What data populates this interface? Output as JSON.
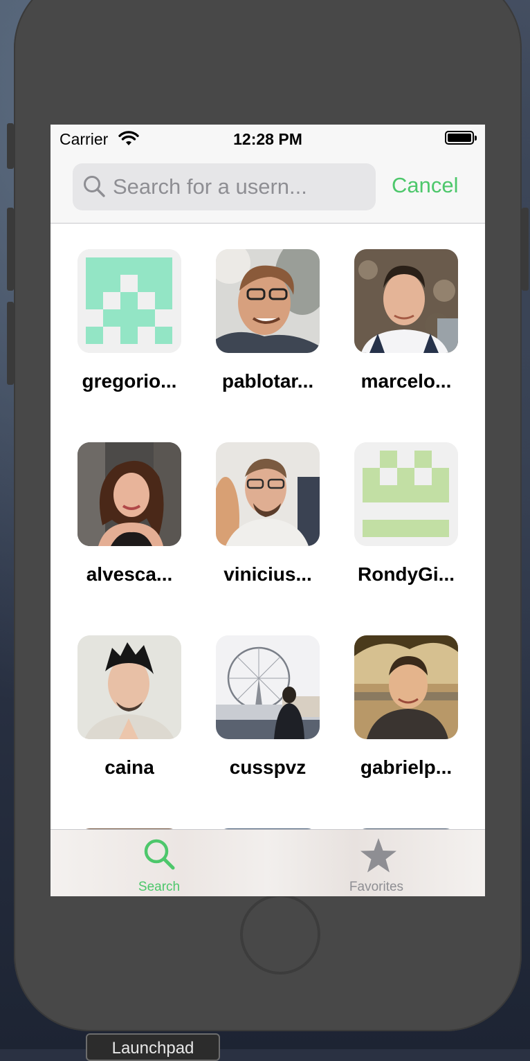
{
  "status_bar": {
    "carrier": "Carrier",
    "time": "12:28 PM"
  },
  "search": {
    "placeholder": "Search for a usern...",
    "cancel_label": "Cancel"
  },
  "users": [
    {
      "username": "gregorio...",
      "avatar": "identicon-teal"
    },
    {
      "username": "pablotar...",
      "avatar": "photo-man-glasses"
    },
    {
      "username": "marcelo...",
      "avatar": "photo-man-wall"
    },
    {
      "username": "alvesca...",
      "avatar": "photo-woman"
    },
    {
      "username": "vinicius...",
      "avatar": "photo-man-glasses-beard"
    },
    {
      "username": "RondyGi...",
      "avatar": "identicon-green"
    },
    {
      "username": "caina",
      "avatar": "photo-young-man"
    },
    {
      "username": "cusspvz",
      "avatar": "photo-ferris-wheel"
    },
    {
      "username": "gabrielp...",
      "avatar": "photo-man-outdoors"
    }
  ],
  "tab_bar": {
    "search_label": "Search",
    "favorites_label": "Favorites"
  },
  "desktop": {
    "tooltip": "Launchpad"
  },
  "colors": {
    "accent": "#4dc76b",
    "inactive": "#8e8e93",
    "identicon_teal": "#93e5c5",
    "identicon_green": "#c2dfa4"
  }
}
